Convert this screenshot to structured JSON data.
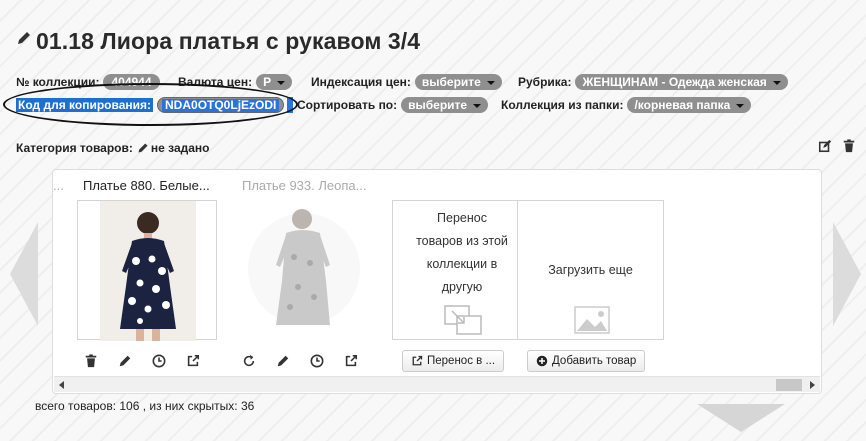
{
  "page": {
    "title": "01.18 Лиора платья с рукавом 3/4"
  },
  "fields": {
    "collection_no": {
      "label": "№ коллекции:",
      "value": "404944"
    },
    "currency": {
      "label": "Валюта цен:",
      "value": "Р"
    },
    "indexation": {
      "label": "Индексация цен:",
      "value": "выберите"
    },
    "rubric": {
      "label": "Рубрика:",
      "value": "ЖЕНЩИНАМ - Одежда женская"
    },
    "copy_code": {
      "label": "Код для копирования:",
      "value": "NDA0OTQ0LjEzODI"
    },
    "sort_by": {
      "label": "Сортировать по:",
      "value": "выберите"
    },
    "folder": {
      "label": "Коллекция из папки:",
      "value": "/корневая папка"
    }
  },
  "category": {
    "label": "Категория товаров:",
    "value": "не задано"
  },
  "products": {
    "ellipsis": "...",
    "captions": [
      "Платье 880. Белые...",
      "Платье 933. Леопа..."
    ],
    "transfer_card_text": [
      "Перенос",
      "товаров из этой",
      "коллекции в",
      "другую"
    ],
    "load_more_text": "Загрузить еще",
    "transfer_button": "Перенос в ...",
    "add_button": "Добавить товар"
  },
  "footer": {
    "total": "всего товаров: 106 , из них скрытых: 36"
  },
  "colors": {
    "pill": "#8f8f8f",
    "selection": "#1f6fd1",
    "nav_arrow": "#dcdcdc"
  },
  "icons": [
    "pencil-icon",
    "edit-square-icon",
    "trash-icon",
    "clock-icon",
    "share-icon",
    "refresh-icon",
    "image-placeholder-icon",
    "plus-circle-icon"
  ]
}
